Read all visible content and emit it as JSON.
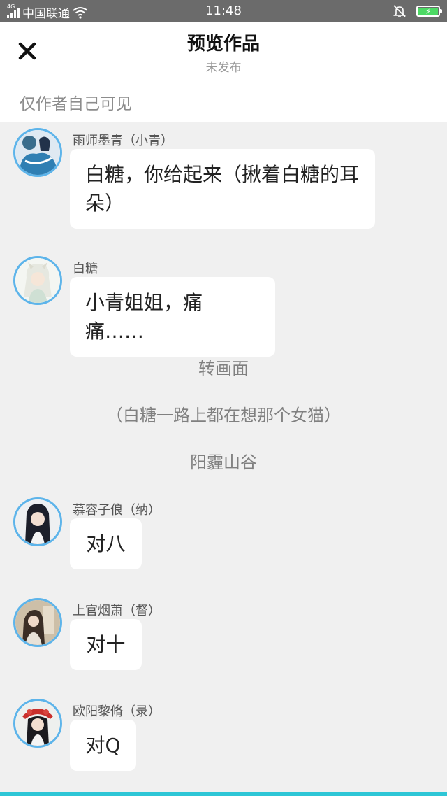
{
  "status_bar": {
    "network": "4G",
    "carrier": "中国联通",
    "time": "11:48"
  },
  "header": {
    "close_icon": "close-icon",
    "title": "预览作品",
    "subtitle": "未发布"
  },
  "notice": "仅作者自己可见",
  "messages": [
    {
      "name": "雨师墨青（小青）",
      "text": "白糖，你给起来（揪着白糖的耳朵）",
      "avatar": "avatar-blue-dress"
    },
    {
      "name": "白糖",
      "text": "小青姐姐，痛痛……",
      "avatar": "avatar-white-hair"
    },
    {
      "name": "慕容子俍（纳）",
      "text": "对八",
      "avatar": "avatar-dark-hair"
    },
    {
      "name": "上官烟萧（督）",
      "text": "对十",
      "avatar": "avatar-brown-room"
    },
    {
      "name": "欧阳黎脩（录）",
      "text": "对Q",
      "avatar": "avatar-red-headdress"
    }
  ],
  "narrations": [
    "转画面",
    "（白糖一路上都在想那个女猫）",
    "阳霾山谷"
  ],
  "colors": {
    "status_bar": "#6b6b6b",
    "avatar_ring": "#5db4ea",
    "bottom_accent": "#2ec6d6",
    "background": "#f0f0f0"
  }
}
